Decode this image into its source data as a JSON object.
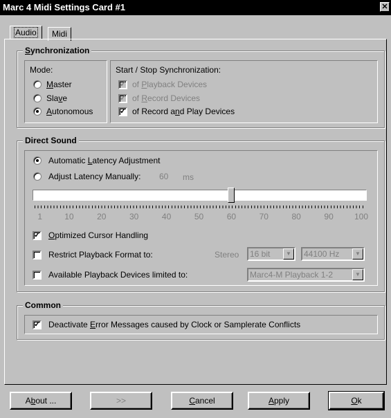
{
  "window": {
    "title": "Marc 4 Midi Settings Card #1",
    "close_glyph": "✕"
  },
  "tabs": [
    {
      "label": "Audio",
      "active": true
    },
    {
      "label": "Midi",
      "active": false
    }
  ],
  "sync": {
    "title_u": "S",
    "title_rest": "ynchronization",
    "mode_label": "Mode:",
    "modes": [
      {
        "pre": "",
        "u": "M",
        "post": "aster",
        "checked": false
      },
      {
        "pre": "Sla",
        "u": "v",
        "post": "e",
        "checked": false
      },
      {
        "pre": "",
        "u": "A",
        "post": "utonomous",
        "checked": true
      }
    ],
    "startstop_label": "Start / Stop Synchronization:",
    "options": [
      {
        "pre": "of ",
        "u": "P",
        "post": "layback Devices",
        "checked": true,
        "disabled": true
      },
      {
        "pre": "of ",
        "u": "R",
        "post": "ecord Devices",
        "checked": true,
        "disabled": true
      },
      {
        "pre": "of Record a",
        "u": "n",
        "post": "d Play Devices",
        "checked": true,
        "disabled": false
      }
    ]
  },
  "direct_sound": {
    "title": "Direct Sound",
    "auto": {
      "pre": "Automatic ",
      "u": "L",
      "post": "atency Adjustment",
      "checked": true
    },
    "manual": {
      "pre": "Ad",
      "u": "j",
      "post": "ust Latency Manually:",
      "checked": false,
      "value": "60",
      "unit": "ms"
    },
    "slider": {
      "value": 60,
      "min": 0,
      "max": 100,
      "labels": [
        "1",
        "10",
        "20",
        "30",
        "40",
        "50",
        "60",
        "70",
        "80",
        "90",
        "100"
      ]
    },
    "optimized": {
      "pre": "",
      "u": "O",
      "post": "ptimized Cursor Handling",
      "checked": true
    },
    "restrict": {
      "label": "Restrict Playback Format to:",
      "checked": false,
      "stereo": "Stereo",
      "bits": "16 bit",
      "rate": "44100 Hz"
    },
    "available": {
      "label": "Available Playback Devices limited to:",
      "checked": false,
      "device": "Marc4-M Playback 1-2"
    }
  },
  "common": {
    "title": "Common",
    "deactivate": {
      "pre": "Deactivate ",
      "u": "E",
      "post": "rror Messages caused by Clock or Samplerate Conflicts",
      "checked": true
    }
  },
  "buttons": {
    "about": {
      "pre": "A",
      "u": "b",
      "post": "out ..."
    },
    "next": ">>",
    "cancel": {
      "u": "C",
      "post": "ancel"
    },
    "apply": {
      "u": "A",
      "post": "pply"
    },
    "ok": {
      "u": "O",
      "post": "k"
    }
  }
}
